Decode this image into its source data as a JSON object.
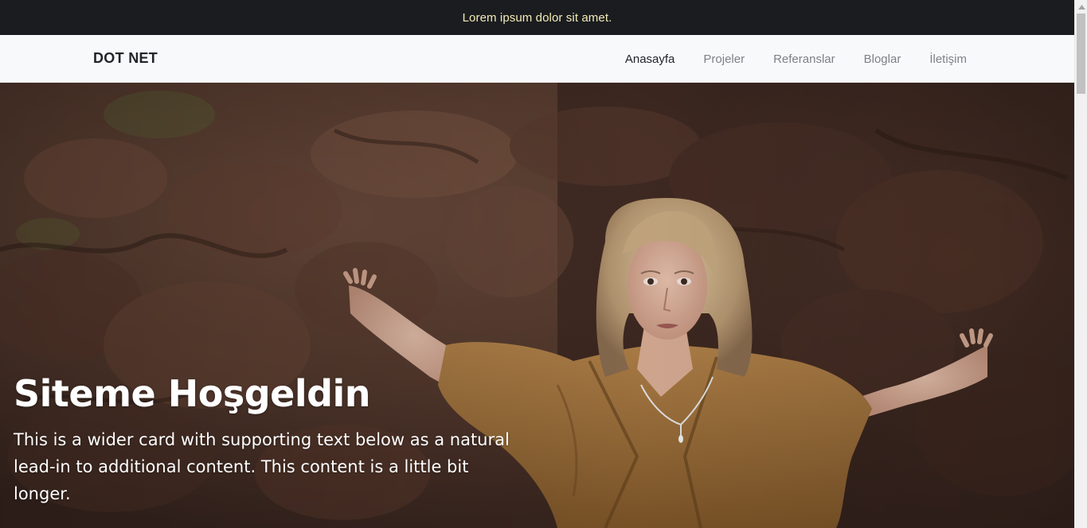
{
  "topbar": {
    "text": "Lorem ipsum dolor sit amet."
  },
  "navbar": {
    "brand": "DOT NET",
    "links": [
      {
        "label": "Anasayfa",
        "active": true
      },
      {
        "label": "Projeler",
        "active": false
      },
      {
        "label": "Referanslar",
        "active": false
      },
      {
        "label": "Bloglar",
        "active": false
      },
      {
        "label": "İletişim",
        "active": false
      }
    ]
  },
  "hero": {
    "title": "Siteme Hoşgeldin",
    "text": "This is a wider card with supporting text below as a natural lead-in to additional content. This content is a little bit longer.",
    "image_icon": "hero-photo-woman-rock-wall"
  },
  "colors": {
    "topbar_bg": "#1a1c20",
    "topbar_text": "#f3ebb4",
    "navbar_bg": "#f8f9fa",
    "nav_active": "#212529",
    "nav_inactive": "#7d8287"
  }
}
